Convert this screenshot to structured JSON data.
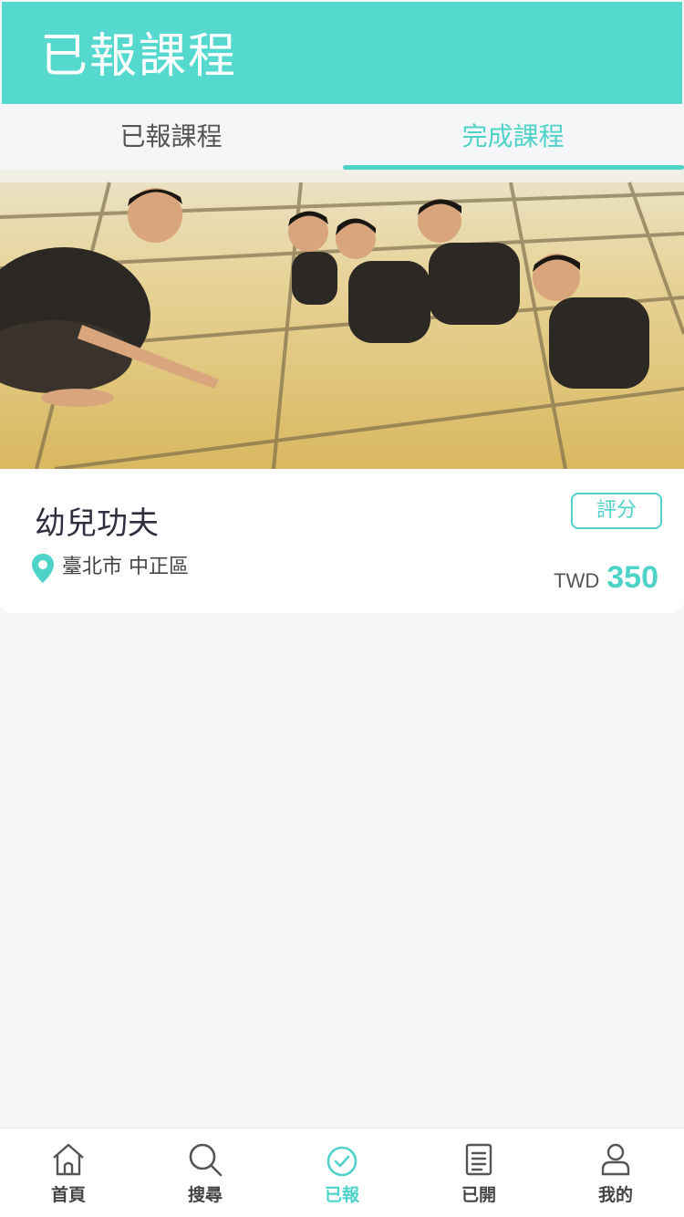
{
  "header": {
    "title": "已報課程"
  },
  "tabs": [
    {
      "label": "已報課程",
      "active": false
    },
    {
      "label": "完成課程",
      "active": true
    }
  ],
  "course": {
    "name": "幼兒功夫",
    "location": "臺北市 中正區",
    "rate_label": "評分",
    "currency": "TWD",
    "price": "350"
  },
  "nav": [
    {
      "label": "首頁",
      "icon": "home-icon"
    },
    {
      "label": "搜尋",
      "icon": "search-icon"
    },
    {
      "label": "已報",
      "icon": "check-circle-icon",
      "active": true
    },
    {
      "label": "已開",
      "icon": "document-icon"
    },
    {
      "label": "我的",
      "icon": "user-icon"
    }
  ],
  "colors": {
    "accent": "#4fd3c8",
    "header": "#55d9cf",
    "background": "#f5f6f8"
  }
}
